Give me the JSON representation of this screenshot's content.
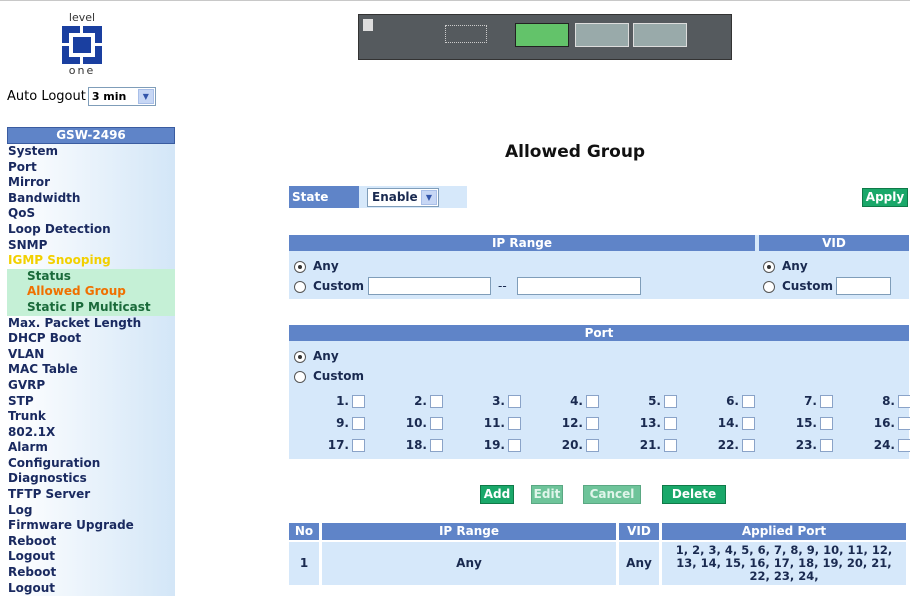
{
  "logo": {
    "top_text": "level",
    "bottom_text": "one"
  },
  "auto_logout": {
    "label": "Auto Logout",
    "value": "3 min"
  },
  "sidebar": {
    "header": "GSW-2496",
    "items_before": [
      "System",
      "Port",
      "Mirror",
      "Bandwidth",
      "QoS",
      "Loop Detection",
      "SNMP"
    ],
    "active_item": "IGMP Snooping",
    "sub_items": [
      "Status",
      "Allowed Group",
      "Static IP Multicast"
    ],
    "current_sub": "Allowed Group",
    "items_after": [
      "Max. Packet Length",
      "DHCP Boot",
      "VLAN",
      "MAC Table",
      "GVRP",
      "STP",
      "Trunk",
      "802.1X",
      "Alarm",
      "Configuration",
      "Diagnostics",
      "TFTP Server",
      "Log",
      "Firmware Upgrade",
      "Reboot",
      "Logout",
      "Reboot",
      "Logout"
    ]
  },
  "page": {
    "title": "Allowed Group"
  },
  "state": {
    "label": "State",
    "value": "Enable"
  },
  "buttons": {
    "apply": "Apply",
    "add": "Add",
    "edit": "Edit",
    "cancel": "Cancel",
    "delete": "Delete"
  },
  "ip_range": {
    "header": "IP Range",
    "any": "Any",
    "custom": "Custom",
    "separator": "--"
  },
  "vid": {
    "header": "VID",
    "any": "Any",
    "custom": "Custom"
  },
  "port": {
    "header": "Port",
    "any": "Any",
    "custom": "Custom",
    "labels": [
      "1.",
      "2.",
      "3.",
      "4.",
      "5.",
      "6.",
      "7.",
      "8.",
      "9.",
      "10.",
      "11.",
      "12.",
      "13.",
      "14.",
      "15.",
      "16.",
      "17.",
      "18.",
      "19.",
      "20.",
      "21.",
      "22.",
      "23.",
      "24."
    ]
  },
  "table": {
    "headers": {
      "no": "No",
      "ip_range": "IP Range",
      "vid": "VID",
      "applied_port": "Applied Port"
    },
    "rows": [
      {
        "no": "1",
        "ip_range": "Any",
        "vid": "Any",
        "applied_port": "1, 2, 3, 4, 5, 6, 7, 8, 9, 10, 11, 12, 13, 14, 15, 16, 17, 18, 19, 20, 21, 22, 23, 24,"
      }
    ]
  },
  "colors": {
    "header_blue": "#5f84c8",
    "panel_blue": "#d6e8fa",
    "button_green": "#1aa86a",
    "active_yellow": "#f2d000",
    "current_orange": "#f07000"
  }
}
